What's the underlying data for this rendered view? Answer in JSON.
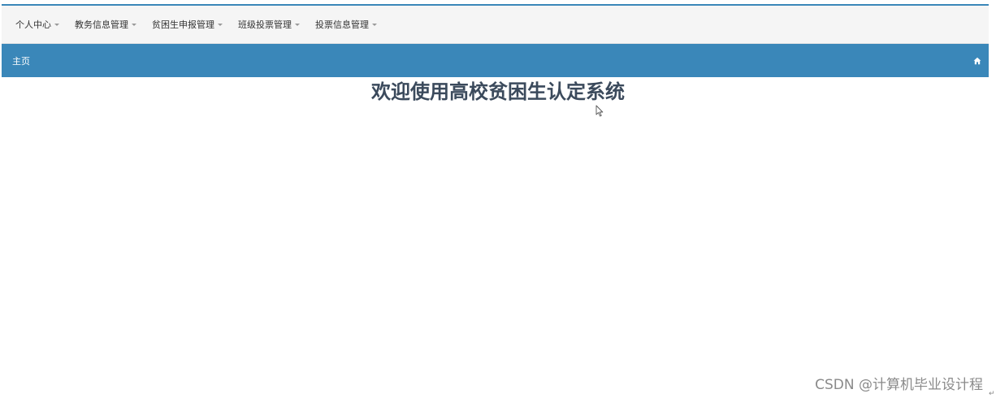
{
  "nav": {
    "items": [
      {
        "label": "个人中心"
      },
      {
        "label": "教务信息管理"
      },
      {
        "label": "贫困生申报管理"
      },
      {
        "label": "班级投票管理"
      },
      {
        "label": "投票信息管理"
      }
    ]
  },
  "breadcrumb": {
    "label": "主页",
    "icon": "home-icon"
  },
  "main": {
    "welcome_title": "欢迎使用高校贫困生认定系统"
  },
  "watermark": {
    "text": "CSDN @计算机毕业设计程",
    "return_mark": "↵"
  },
  "colors": {
    "accent": "#3a87b9",
    "topbar_bg": "#f5f5f5",
    "title_text": "#3b4a5c"
  }
}
